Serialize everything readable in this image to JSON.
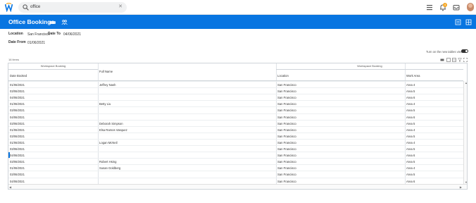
{
  "topbar": {
    "search_value": "office",
    "notification_count": "4",
    "icons": [
      "workday-logo-icon",
      "search-icon",
      "clear-icon",
      "apps-grid-icon",
      "bell-icon",
      "inbox-icon",
      "avatar"
    ]
  },
  "header": {
    "title": "Office Bookings",
    "accent": "#0875e1"
  },
  "fields": {
    "location_label": "Location",
    "location_value": "San Francisco",
    "date_to_label": "Date To",
    "date_to_value": "04/06/2021",
    "date_from_label": "Date From",
    "date_from_value": "01/06/2021"
  },
  "toggle_label": "Turn on the new tables view",
  "items_count": "16 items",
  "grid": {
    "group1": "Workspace Booking",
    "group2": "Workspace Booking",
    "headers": [
      "Date Booked",
      "Full Name",
      "Location",
      "Work Area"
    ],
    "rows": [
      [
        "01/06/2021",
        "Jeffrey Nash",
        "San Francisco",
        "Area 4"
      ],
      [
        "03/06/2021",
        "",
        "San Francisco",
        "Area 5"
      ],
      [
        "04/06/2021",
        "",
        "San Francisco",
        "Area 6"
      ],
      [
        "01/06/2021",
        "Betty Liu",
        "San Francisco",
        "Area 4"
      ],
      [
        "03/06/2021",
        "",
        "San Francisco",
        "Area 5"
      ],
      [
        "04/06/2021",
        "",
        "San Francisco",
        "Area 6"
      ],
      [
        "03/06/2021",
        "Deborah Simpson",
        "San Francisco",
        "Area 5"
      ],
      [
        "01/06/2021",
        "Elsa Ramos Vasquez",
        "San Francisco",
        "Area 4"
      ],
      [
        "03/06/2021",
        "",
        "San Francisco",
        "Area 5"
      ],
      [
        "01/06/2021",
        "Logan McNeil",
        "San Francisco",
        "Area 4"
      ],
      [
        "03/06/2021",
        "",
        "San Francisco",
        "Area 5"
      ],
      [
        "04/06/2021",
        "",
        "San Francisco",
        "Area 6"
      ],
      [
        "03/06/2021",
        "Robert Hsing",
        "San Francisco",
        "Area 5"
      ],
      [
        "01/06/2021",
        "Susan Goldberg",
        "San Francisco",
        "Area 4"
      ],
      [
        "03/06/2021",
        "",
        "San Francisco",
        "Area 5"
      ],
      [
        "04/06/2021",
        "",
        "San Francisco",
        "Area 6"
      ]
    ]
  }
}
